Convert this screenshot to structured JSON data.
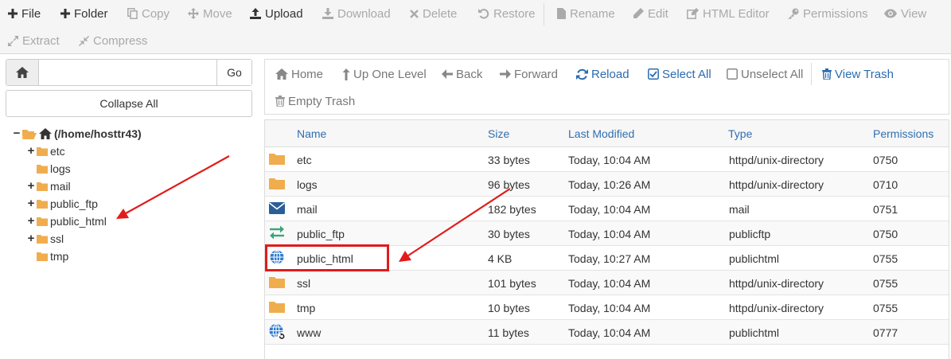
{
  "toolbar": {
    "file": "File",
    "folder": "Folder",
    "copy": "Copy",
    "move": "Move",
    "upload": "Upload",
    "download": "Download",
    "delete": "Delete",
    "restore": "Restore",
    "rename": "Rename",
    "edit": "Edit",
    "html_editor": "HTML Editor",
    "permissions": "Permissions",
    "view": "View",
    "extract": "Extract",
    "compress": "Compress"
  },
  "sidebar": {
    "search_value": "",
    "go_label": "Go",
    "collapse_label": "Collapse All",
    "tree_root": "(/home/hosttr43)",
    "tree": [
      {
        "label": "etc"
      },
      {
        "label": "logs"
      },
      {
        "label": "mail"
      },
      {
        "label": "public_ftp"
      },
      {
        "label": "public_html"
      },
      {
        "label": "ssl"
      },
      {
        "label": "tmp"
      }
    ]
  },
  "nav": {
    "home": "Home",
    "up_one_level": "Up One Level",
    "back": "Back",
    "forward": "Forward",
    "reload": "Reload",
    "select_all": "Select All",
    "unselect_all": "Unselect All",
    "view_trash": "View Trash",
    "empty_trash": "Empty Trash"
  },
  "table": {
    "headers": {
      "name": "Name",
      "size": "Size",
      "modified": "Last Modified",
      "type": "Type",
      "perms": "Permissions"
    },
    "rows": [
      {
        "icon": "folder-icon",
        "name": "etc",
        "size": "33 bytes",
        "modified": "Today, 10:04 AM",
        "type": "httpd/unix-directory",
        "perms": "0750"
      },
      {
        "icon": "folder-icon",
        "name": "logs",
        "size": "96 bytes",
        "modified": "Today, 10:26 AM",
        "type": "httpd/unix-directory",
        "perms": "0710"
      },
      {
        "icon": "envelope-icon",
        "name": "mail",
        "size": "182 bytes",
        "modified": "Today, 10:04 AM",
        "type": "mail",
        "perms": "0751"
      },
      {
        "icon": "transfer-arrows-icon",
        "name": "public_ftp",
        "size": "30 bytes",
        "modified": "Today, 10:04 AM",
        "type": "publicftp",
        "perms": "0750"
      },
      {
        "icon": "globe-icon",
        "name": "public_html",
        "size": "4 KB",
        "modified": "Today, 10:27 AM",
        "type": "publichtml",
        "perms": "0755"
      },
      {
        "icon": "folder-icon",
        "name": "ssl",
        "size": "101 bytes",
        "modified": "Today, 10:04 AM",
        "type": "httpd/unix-directory",
        "perms": "0755"
      },
      {
        "icon": "folder-icon",
        "name": "tmp",
        "size": "10 bytes",
        "modified": "Today, 10:04 AM",
        "type": "httpd/unix-directory",
        "perms": "0755"
      },
      {
        "icon": "globe-link-icon",
        "name": "www",
        "size": "11 bytes",
        "modified": "Today, 10:04 AM",
        "type": "publichtml",
        "perms": "0777"
      }
    ]
  },
  "colors": {
    "folder": "#f0ad4e",
    "link_blue": "#2f6fb0",
    "highlight_red": "#e21b1b",
    "toolbar_bg": "#f5f5f5"
  }
}
